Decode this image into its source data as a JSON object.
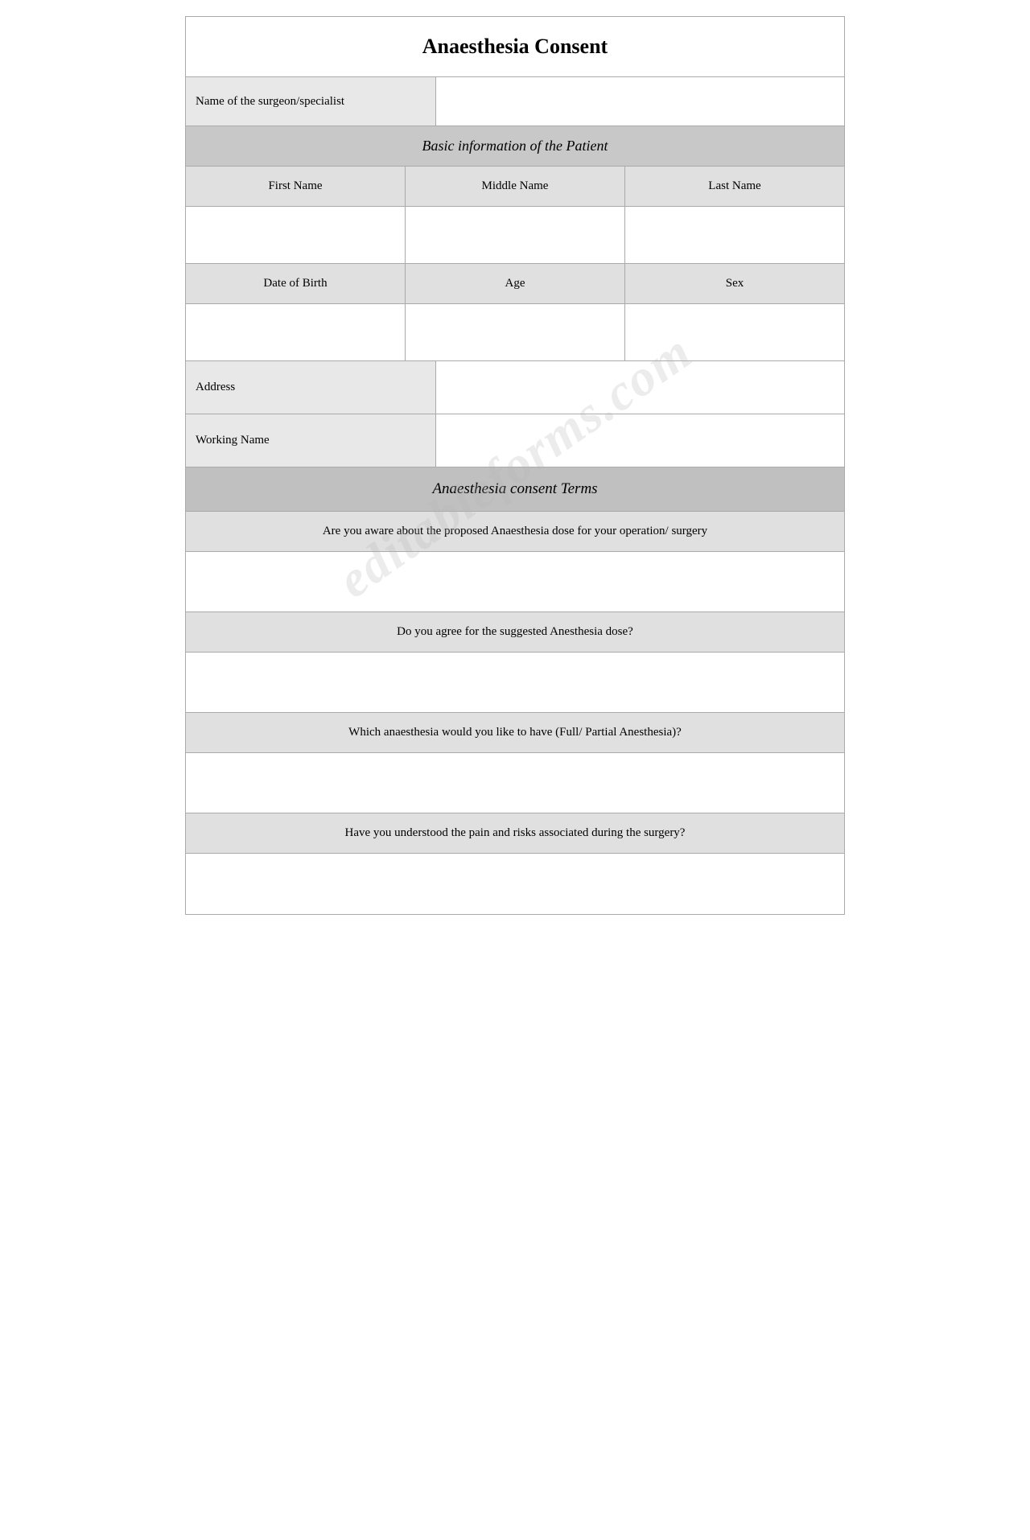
{
  "title": "Anaesthesia Consent",
  "watermark": "editableforms.com",
  "surgeon": {
    "label": "Name of the surgeon/specialist",
    "value": ""
  },
  "basic_info": {
    "header": "Basic information of the Patient",
    "columns": {
      "first": "First Name",
      "middle": "Middle Name",
      "last": "Last Name"
    },
    "dob_row": {
      "dob": "Date of Birth",
      "age": "Age",
      "sex": "Sex"
    },
    "address_label": "Address",
    "working_name_label": "Working Name"
  },
  "terms": {
    "header": "Anaesthesia consent Terms",
    "questions": [
      "Are you aware about the proposed Anaesthesia dose for your operation/ surgery",
      "Do you agree for the suggested Anesthesia dose?",
      "Which anaesthesia would you like to have (Full/ Partial Anesthesia)?",
      "Have you understood the pain and risks associated during the surgery?"
    ]
  }
}
